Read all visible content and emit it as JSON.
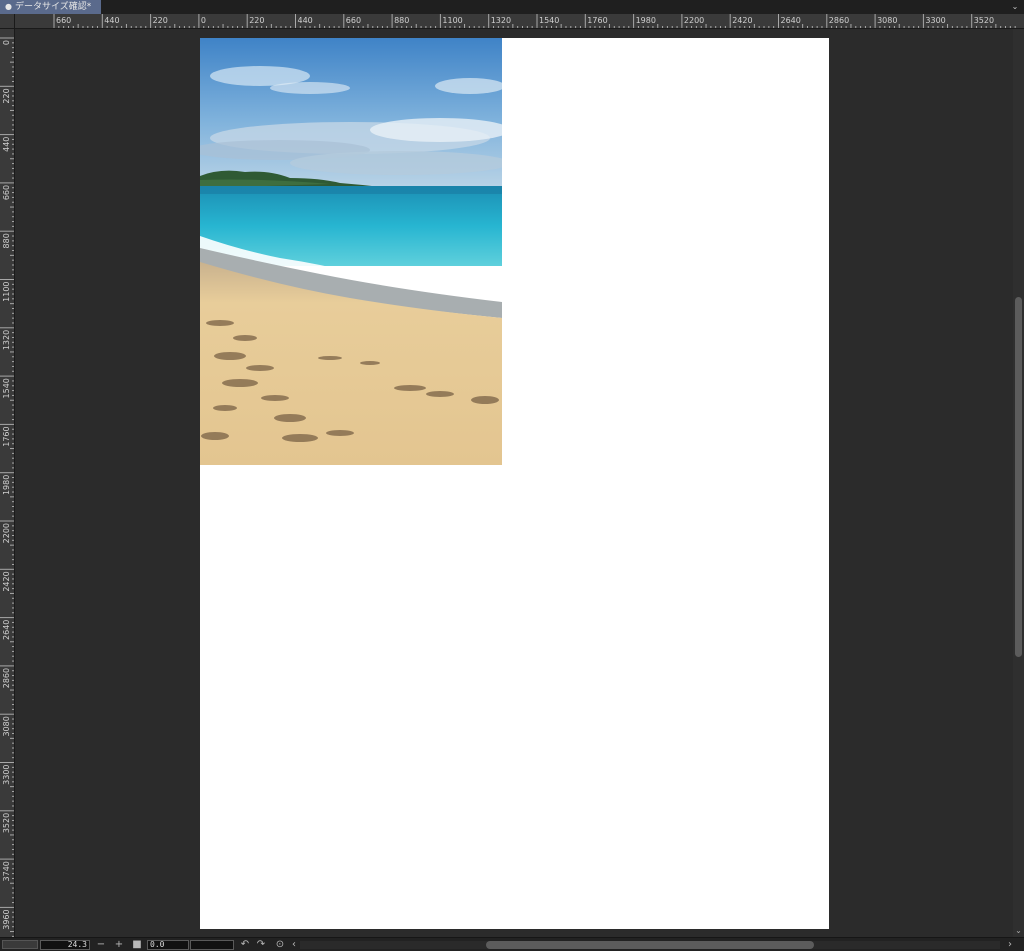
{
  "tab": {
    "title": "データサイズ確認*",
    "dot": "●"
  },
  "rulers": {
    "horizontal_labels": [
      "660",
      "440",
      "220",
      "0",
      "220",
      "440",
      "660",
      "880",
      "1100",
      "1320",
      "1540",
      "1760",
      "1980",
      "2200",
      "2420",
      "2640",
      "2860",
      "3080",
      "3300",
      "3520"
    ],
    "vertical_labels": [
      "0",
      "220",
      "440",
      "660",
      "880",
      "1100",
      "1320",
      "1540",
      "1760",
      "1980",
      "2200",
      "2420",
      "2640",
      "2860",
      "3080",
      "3300",
      "3520",
      "3740",
      "3960"
    ]
  },
  "bottom_bar": {
    "zoom_value": "24.3",
    "zoom_out_icon": "minus-icon",
    "zoom_in_icon": "plus-icon",
    "fit_icon": "square-icon",
    "angle_value": "0.0",
    "rotate_left_icon": "rotate-left-icon",
    "rotate_right_icon": "rotate-right-icon",
    "reset_icon": "reset-rotation-icon"
  },
  "colors": {
    "background": "#2b2b2b",
    "tab_active": "#5a6a8c",
    "page": "#ffffff"
  }
}
